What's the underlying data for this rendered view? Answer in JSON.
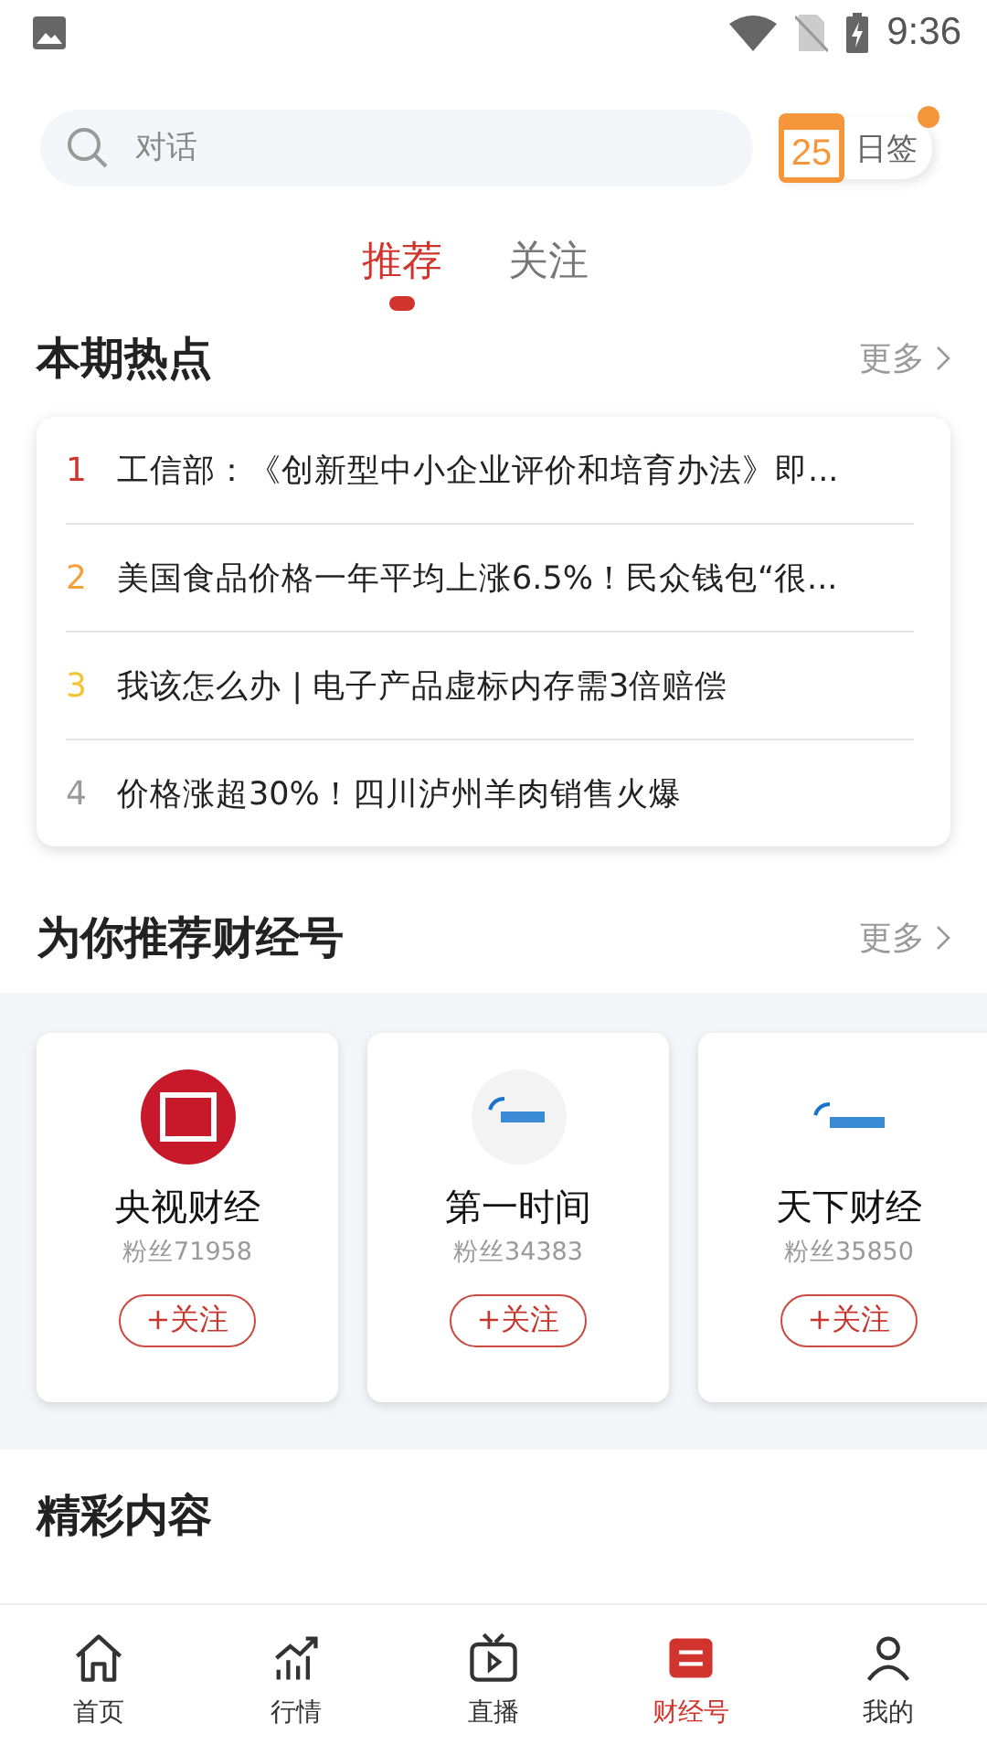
{
  "status_bar": {
    "time": "9:36"
  },
  "search": {
    "placeholder": "对话"
  },
  "checkin": {
    "day": "25",
    "label": "日签",
    "has_dot": true
  },
  "feed_tabs": [
    {
      "label": "推荐",
      "selected": true
    },
    {
      "label": "关注",
      "selected": false
    }
  ],
  "hot": {
    "title": "本期热点",
    "more": "更多",
    "items": [
      {
        "rank": "1",
        "text": "工信部：《创新型中小企业评价和培育办法》即...",
        "color": "#d0342c"
      },
      {
        "rank": "2",
        "text": "美国食品价格一年平均上涨6.5%！民众钱包“很...",
        "color": "#f5a03a"
      },
      {
        "rank": "3",
        "text": "我该怎么办 | 电子产品虚标内存需3倍赔偿",
        "color": "#f3c431"
      },
      {
        "rank": "4",
        "text": "价格涨超30%！四川泸州羊肉销售火爆",
        "color": "#999999"
      }
    ]
  },
  "accounts": {
    "title": "为你推荐财经号",
    "more": "更多",
    "items": [
      {
        "name": "央视财经",
        "fans": "粉丝71958",
        "follow": "+关注",
        "kind": "red"
      },
      {
        "name": "第一时间",
        "fans": "粉丝34383",
        "follow": "+关注",
        "kind": "grey"
      },
      {
        "name": "天下财经",
        "fans": "粉丝35850",
        "follow": "+关注",
        "kind": "plain"
      }
    ]
  },
  "content": {
    "title": "精彩内容"
  },
  "nav": [
    {
      "label": "首页",
      "kind": "home",
      "selected": false
    },
    {
      "label": "行情",
      "kind": "chart",
      "selected": false
    },
    {
      "label": "直播",
      "kind": "tv",
      "selected": false
    },
    {
      "label": "财经号",
      "kind": "account",
      "selected": true
    },
    {
      "label": "我的",
      "kind": "me",
      "selected": false
    }
  ]
}
